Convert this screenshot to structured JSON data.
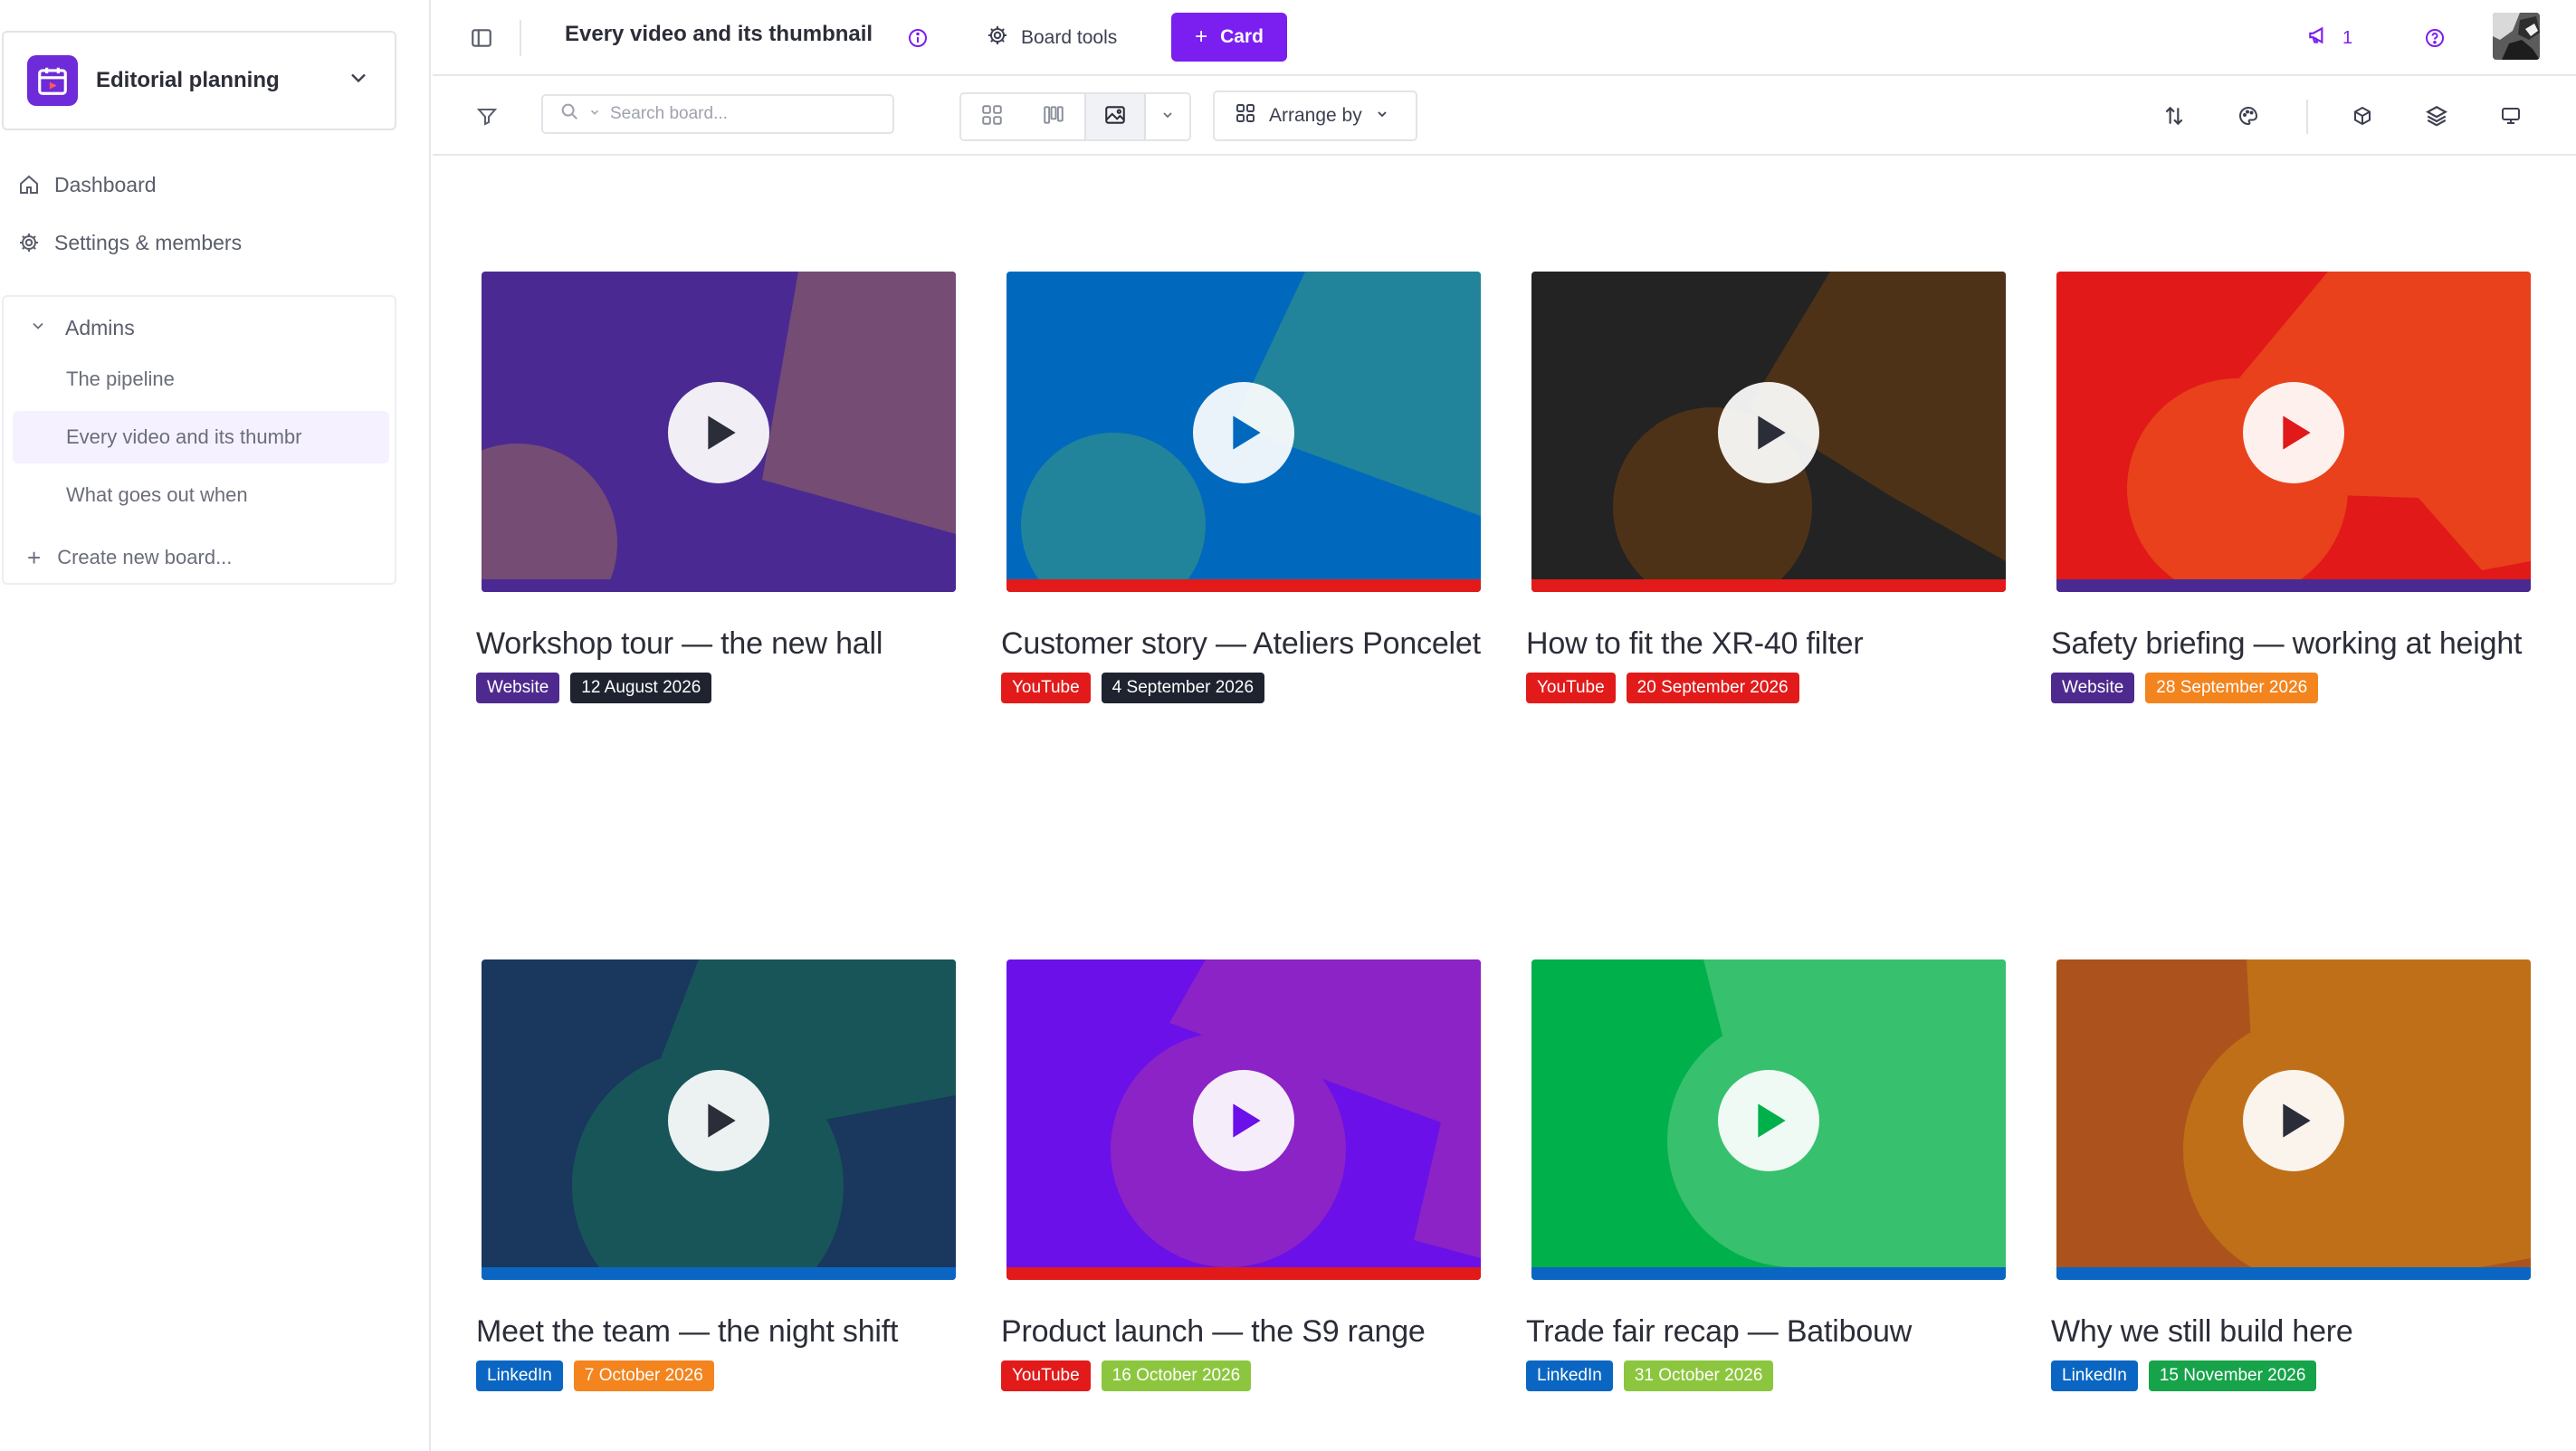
{
  "workspace": {
    "title": "Editorial planning",
    "icon": "calendar-icon",
    "accent": "#6d2bd9"
  },
  "sidebar": {
    "links": [
      {
        "label": "Dashboard",
        "icon": "home-icon"
      },
      {
        "label": "Settings & members",
        "icon": "gear-icon"
      }
    ],
    "group": {
      "label": "Admins",
      "boards": [
        {
          "label": "The pipeline",
          "active": false
        },
        {
          "label": "Every video and its thumbr",
          "active": true
        },
        {
          "label": "What goes out when",
          "active": false
        }
      ],
      "create_label": "Create new board..."
    }
  },
  "topbar": {
    "board_title": "Every video and its thumbnail",
    "board_tools_label": "Board tools",
    "add_card_label": "Card",
    "announcements_count": "1",
    "accent": "#7b1ff0"
  },
  "toolbar": {
    "search_placeholder": "Search board...",
    "arrange_label": "Arrange by",
    "views": [
      "grid-view",
      "kanban-view",
      "gallery-view"
    ],
    "active_view": "gallery-view"
  },
  "cards": [
    {
      "title": "Workshop tour — the new hall",
      "channel": "Website",
      "channel_color": "#4e2a8e",
      "date": "12 August 2026",
      "date_color": "#1f2330",
      "thumb_base": "#4a2a92",
      "thumb_shape": "#744c74",
      "stripe": "#4a2a92"
    },
    {
      "title": "Customer story — Ateliers Poncelet",
      "channel": "YouTube",
      "channel_color": "#e21a1a",
      "date": "4 September 2026",
      "date_color": "#1f2330",
      "thumb_base": "#0069bd",
      "thumb_shape": "#21849b",
      "stripe": "#e21a1a"
    },
    {
      "title": "How to fit the XR-40 filter",
      "channel": "YouTube",
      "channel_color": "#e21a1a",
      "date": "20 September 2026",
      "date_color": "#e21a1a",
      "thumb_base": "#232323",
      "thumb_shape": "#4e3218",
      "stripe": "#e21a1a"
    },
    {
      "title": "Safety briefing — working at height",
      "channel": "Website",
      "channel_color": "#4e2a8e",
      "date": "28 September 2026",
      "date_color": "#f3841e",
      "thumb_base": "#e11919",
      "thumb_shape": "#e8411b",
      "stripe": "#4a2a92"
    },
    {
      "title": "Meet the team — the night shift",
      "channel": "LinkedIn",
      "channel_color": "#0a66c2",
      "date": "7 October 2026",
      "date_color": "#f3841e",
      "thumb_base": "#1a375e",
      "thumb_shape": "#175559",
      "stripe": "#0a66c2"
    },
    {
      "title": "Product launch — the S9 range",
      "channel": "YouTube",
      "channel_color": "#e21a1a",
      "date": "16 October 2026",
      "date_color": "#8cc63f",
      "thumb_base": "#6b10e8",
      "thumb_shape": "#8b23c6",
      "stripe": "#e21a1a"
    },
    {
      "title": "Trade fair recap — Batibouw",
      "channel": "LinkedIn",
      "channel_color": "#0a66c2",
      "date": "31 October 2026",
      "date_color": "#8cc63f",
      "thumb_base": "#00b04a",
      "thumb_shape": "#37c06e",
      "stripe": "#0a66c2"
    },
    {
      "title": "Why we still build here",
      "channel": "LinkedIn",
      "channel_color": "#0a66c2",
      "date": "15 November 2026",
      "date_color": "#16a34a",
      "thumb_base": "#ac531d",
      "thumb_shape": "#bf6f18",
      "stripe": "#0a66c2"
    }
  ]
}
